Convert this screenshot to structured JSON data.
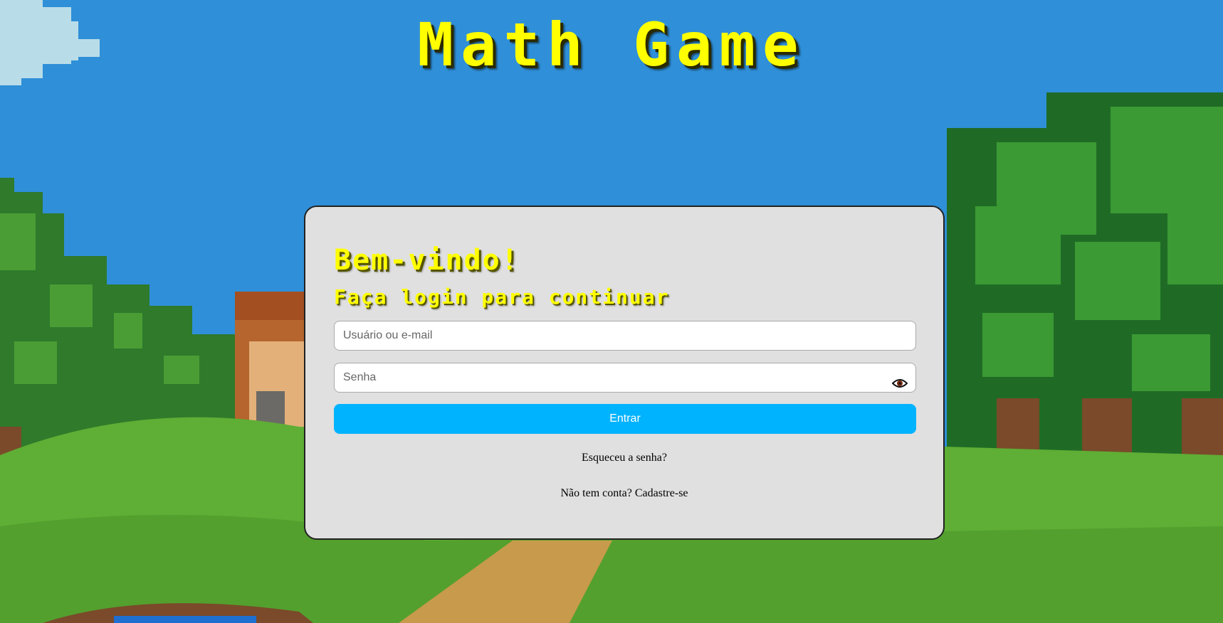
{
  "header": {
    "title": "Math Game"
  },
  "login": {
    "welcome": "Bem-vindo!",
    "subtitle": "Faça login para continuar",
    "username_placeholder": "Usuário ou e-mail",
    "password_placeholder": "Senha",
    "submit_label": "Entrar",
    "forgot_password": "Esqueceu a senha?",
    "register_prompt": "Não tem conta? Cadastre-se",
    "show_password_icon": "eye-icon"
  },
  "colors": {
    "title": "#ffff00",
    "card_background": "#e0e0e0",
    "button": "#00b3ff",
    "sky": "#2f8fd8",
    "grass": "#5fae35"
  }
}
